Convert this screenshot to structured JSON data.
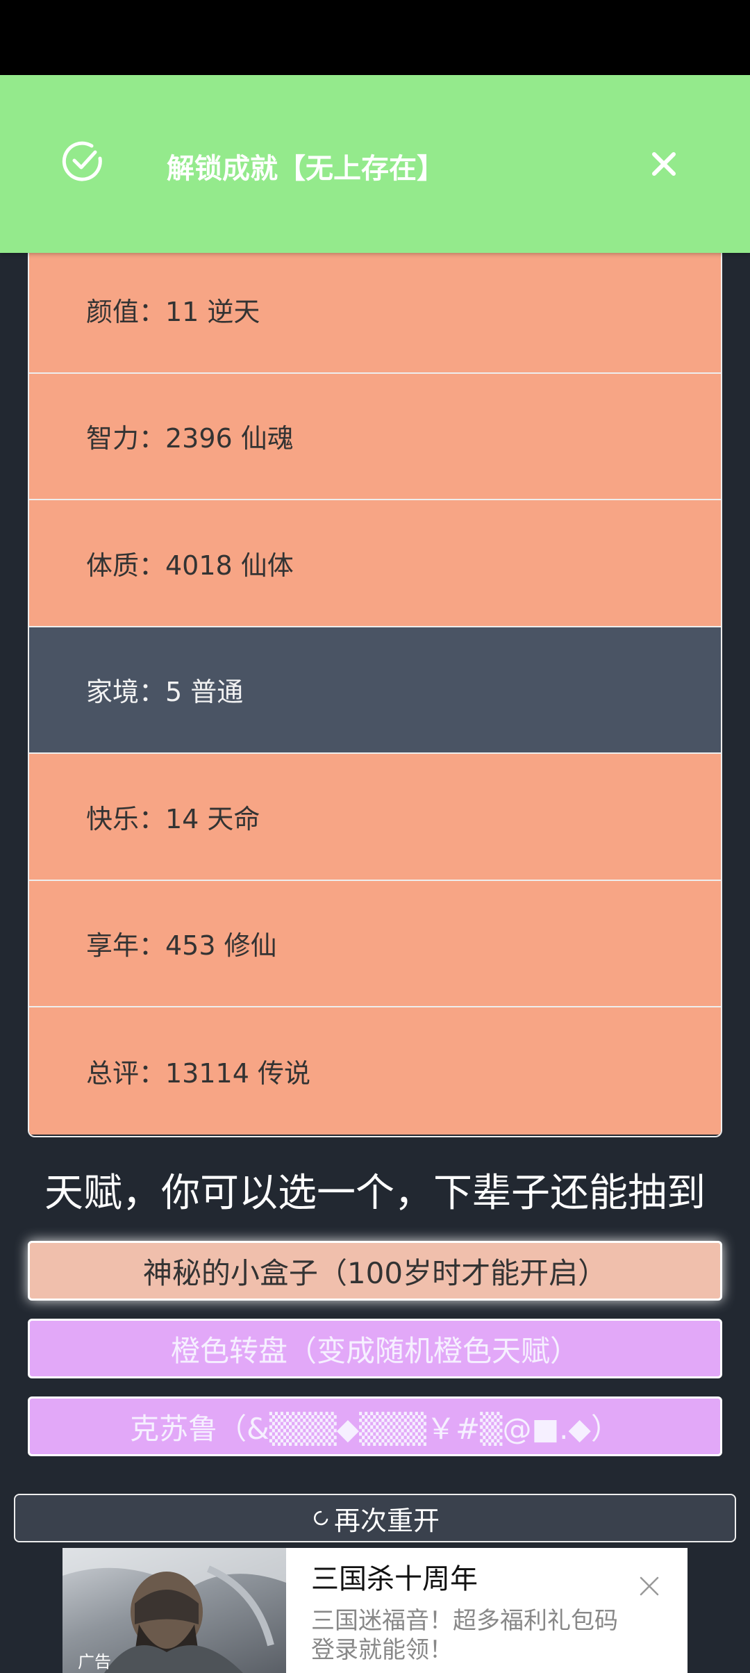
{
  "toast": {
    "message": "解锁成就【无上存在】",
    "icon": "check-circle-icon",
    "close_icon": "close-icon",
    "color": "#94ea8c"
  },
  "stats": [
    {
      "label": "颜值：11 逆天",
      "style": "orange"
    },
    {
      "label": "智力：2396 仙魂",
      "style": "orange"
    },
    {
      "label": "体质：4018 仙体",
      "style": "orange"
    },
    {
      "label": "家境：5 普通",
      "style": "dark"
    },
    {
      "label": "快乐：14 天命",
      "style": "orange"
    },
    {
      "label": "享年：453 修仙",
      "style": "orange"
    },
    {
      "label": "总评：13114 传说",
      "style": "orange"
    }
  ],
  "talents": {
    "heading": "天赋，你可以选一个，下辈子还能抽到",
    "options": [
      {
        "label": "神秘的小盒子（100岁时才能开启）",
        "selected": true
      },
      {
        "label": "橙色转盘（变成随机橙色天赋）",
        "selected": false
      },
      {
        "label": "克苏鲁（&▒▒▒◆▒▒▒￥#▒@■.◆）",
        "selected": false
      }
    ]
  },
  "restart": {
    "label": "再次重开",
    "icon": "refresh-icon"
  },
  "ad": {
    "badge": "广告",
    "title": "三国杀十周年",
    "description": "三国迷福音！超多福利礼包码登录就能领！",
    "close_icon": "close-icon"
  }
}
